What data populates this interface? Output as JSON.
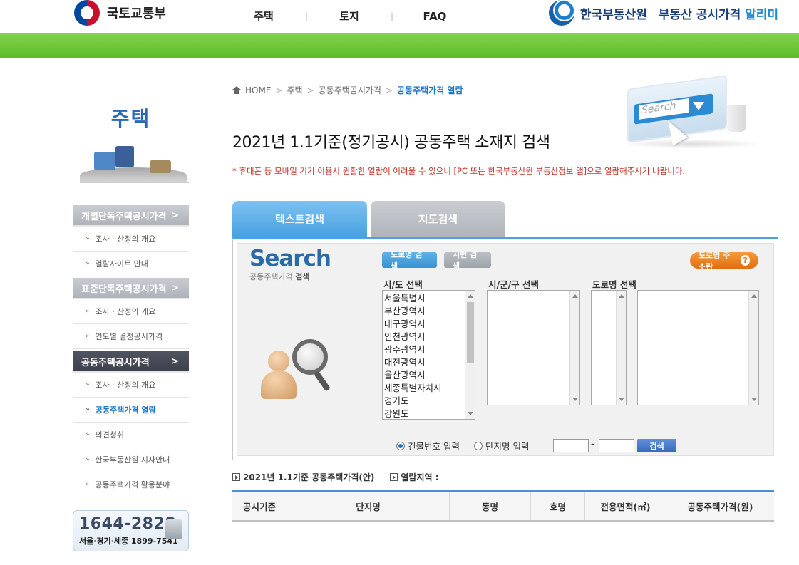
{
  "header": {
    "gov_name": "국토교통부",
    "nav": [
      "주택",
      "토지",
      "FAQ"
    ],
    "nav_sep": "|",
    "reb_name": "한국부동산원",
    "reb_title_main": "부동산 공시가격",
    "reb_title_accent": "알리미"
  },
  "sidebar": {
    "title": "주택",
    "sections": [
      {
        "label": "개별단독주택공시가격",
        "chevron": ">",
        "items": [
          "조사 · 산정의 개요",
          "열람사이트 안내"
        ]
      },
      {
        "label": "표준단독주택공시가격",
        "chevron": ">",
        "items": [
          "조사 · 산정의 개요",
          "연도별 결정공시가격"
        ]
      },
      {
        "label": "공동주택공시가격",
        "chevron": ">",
        "items": [
          "조사 · 산정의 개요",
          "공동주택가격 열람",
          "의견청취",
          "한국부동산원 지사안내",
          "공동주택가격 활용분야"
        ]
      }
    ],
    "bullet": "»",
    "call": {
      "number": "1644-2828",
      "sub": "서울·경기·세종 1899-7541"
    }
  },
  "breadcrumb": {
    "home": "HOME",
    "sep": ">",
    "items": [
      "주택",
      "공동주택공시가격"
    ],
    "current": "공동주택가격 열람"
  },
  "main": {
    "title": "2021년 1.1기준(정기공시) 공동주택 소재지 검색",
    "notice": "* 휴대폰 등 모바일 기기 이용시 원활한 열람이 어려울 수 있으니 [PC 또는 한국부동산원 부동산정보 앱]으로 열람해주시기 바랍니다.",
    "hero_text": "Search",
    "tabs": {
      "text": "텍스트검색",
      "map": "지도검색"
    }
  },
  "search": {
    "logo": "Search",
    "sub_prefix": "공동주택가격 ",
    "sub_bold": "검색",
    "btn_road": "도로명 검색",
    "btn_lot": "지번 검색",
    "btn_guide": "도로명 주소란",
    "guide_q": "?",
    "labels": {
      "sido": "시/도 선택",
      "sigungu": "시/군/구 선택",
      "road": "도로명 선택"
    },
    "sido_options": [
      "서울특별시",
      "부산광역시",
      "대구광역시",
      "인천광역시",
      "광주광역시",
      "대전광역시",
      "울산광역시",
      "세종특별자치시",
      "경기도",
      "강원도"
    ],
    "radio": {
      "building": "건물번호 입력",
      "complex": "단지명 입력"
    },
    "dash": "-",
    "search_btn": "검색"
  },
  "result": {
    "info1": "2021년 1.1기준 공동주택가격(안)",
    "info2": "열람지역 :",
    "columns": [
      "공시기준",
      "단지명",
      "동명",
      "호명",
      "전용면적(㎡)",
      "공동주택가격(원)"
    ]
  },
  "colors": {
    "green_bar": "#5cbb26",
    "brand_blue": "#1a73c4",
    "tab_active": "#46a0e0",
    "notice_red": "#c0302a",
    "guide_orange": "#e06e10"
  }
}
